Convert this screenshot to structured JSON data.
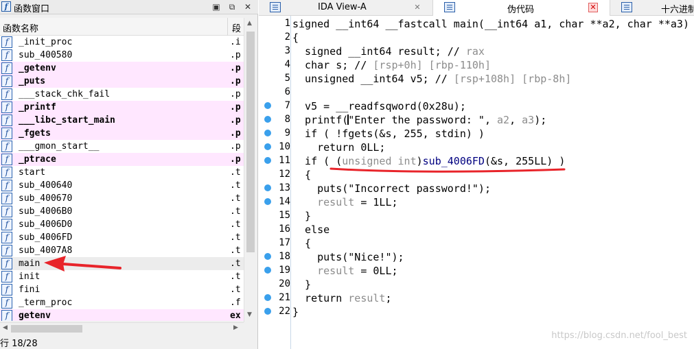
{
  "function_window": {
    "title": "函数窗口",
    "col_name": "函数名称",
    "col_segment": "段",
    "icon_glyph": "f",
    "status": "行 18/28",
    "functions": [
      {
        "name": "_init_proc",
        "segment": ".i",
        "highlight": false
      },
      {
        "name": "sub_400580",
        "segment": ".p",
        "highlight": false
      },
      {
        "name": "_getenv",
        "segment": ".p",
        "highlight": true
      },
      {
        "name": "_puts",
        "segment": ".p",
        "highlight": true
      },
      {
        "name": "___stack_chk_fail",
        "segment": ".p",
        "highlight": false
      },
      {
        "name": "_printf",
        "segment": ".p",
        "highlight": true
      },
      {
        "name": "___libc_start_main",
        "segment": ".p",
        "highlight": true
      },
      {
        "name": "_fgets",
        "segment": ".p",
        "highlight": true
      },
      {
        "name": "___gmon_start__",
        "segment": ".p",
        "highlight": false
      },
      {
        "name": "_ptrace",
        "segment": ".p",
        "highlight": true
      },
      {
        "name": "start",
        "segment": ".t",
        "highlight": false
      },
      {
        "name": "sub_400640",
        "segment": ".t",
        "highlight": false
      },
      {
        "name": "sub_400670",
        "segment": ".t",
        "highlight": false
      },
      {
        "name": "sub_4006B0",
        "segment": ".t",
        "highlight": false
      },
      {
        "name": "sub_4006D0",
        "segment": ".t",
        "highlight": false
      },
      {
        "name": "sub_4006FD",
        "segment": ".t",
        "highlight": false
      },
      {
        "name": "sub_4007A8",
        "segment": ".t",
        "highlight": false
      },
      {
        "name": "main",
        "segment": ".t",
        "highlight": false,
        "selected": true
      },
      {
        "name": "init",
        "segment": ".t",
        "highlight": false
      },
      {
        "name": "fini",
        "segment": ".t",
        "highlight": false
      },
      {
        "name": "_term_proc",
        "segment": ".f",
        "highlight": false
      },
      {
        "name": "getenv",
        "segment": "ex",
        "highlight": true
      }
    ]
  },
  "tabs": [
    {
      "label": "IDA View-A",
      "active": false
    },
    {
      "label": "伪代码",
      "active": true
    },
    {
      "label": "十六进制",
      "active": false
    }
  ],
  "code_lines": [
    {
      "n": "1",
      "dot": false,
      "html": "signed __int64 __fastcall main(__int64 a1, char **a2, char **a3)"
    },
    {
      "n": "2",
      "dot": false,
      "html": "{"
    },
    {
      "n": "3",
      "dot": false,
      "html": "  signed __int64 result; // <span class=\"g\">rax</span>"
    },
    {
      "n": "4",
      "dot": false,
      "html": "  char s; // <span class=\"g\">[rsp+0h] [rbp-110h]</span>"
    },
    {
      "n": "5",
      "dot": false,
      "html": "  unsigned __int64 v5; // <span class=\"g\">[rsp+108h] [rbp-8h]</span>"
    },
    {
      "n": "6",
      "dot": false,
      "html": ""
    },
    {
      "n": "7",
      "dot": true,
      "html": "  v5 = __readfsqword(0x28u);"
    },
    {
      "n": "8",
      "dot": true,
      "html": "  printf(<span class=\"cursor\"></span>\"Enter the password: \", <span class=\"g\">a2</span>, <span class=\"g\">a3</span>);"
    },
    {
      "n": "9",
      "dot": true,
      "html": "  if ( !fgets(&amp;s, 255, stdin) )"
    },
    {
      "n": "10",
      "dot": true,
      "html": "    return 0LL;"
    },
    {
      "n": "11",
      "dot": true,
      "html": "  if ( (<span class=\"g\">unsigned int</span>)<span class=\"b\">sub_4006FD</span>(&amp;s, 255LL) )"
    },
    {
      "n": "12",
      "dot": false,
      "html": "  {"
    },
    {
      "n": "13",
      "dot": true,
      "html": "    puts(\"Incorrect password!\");"
    },
    {
      "n": "14",
      "dot": true,
      "html": "    <span class=\"g\">result</span> = 1LL;"
    },
    {
      "n": "15",
      "dot": false,
      "html": "  }"
    },
    {
      "n": "16",
      "dot": false,
      "html": "  else"
    },
    {
      "n": "17",
      "dot": false,
      "html": "  {"
    },
    {
      "n": "18",
      "dot": true,
      "html": "    puts(\"Nice!\");"
    },
    {
      "n": "19",
      "dot": true,
      "html": "    <span class=\"g\">result</span> = 0LL;"
    },
    {
      "n": "20",
      "dot": false,
      "html": "  }"
    },
    {
      "n": "21",
      "dot": true,
      "html": "  return <span class=\"g\">result</span>;"
    },
    {
      "n": "22",
      "dot": true,
      "html": "}"
    }
  ],
  "watermark": "https://blog.csdn.net/fool_best",
  "colors": {
    "highlight_row": "#ffe7ff",
    "annotation_red": "#e8242a",
    "breakpoint_dot": "#3aa0ec"
  }
}
